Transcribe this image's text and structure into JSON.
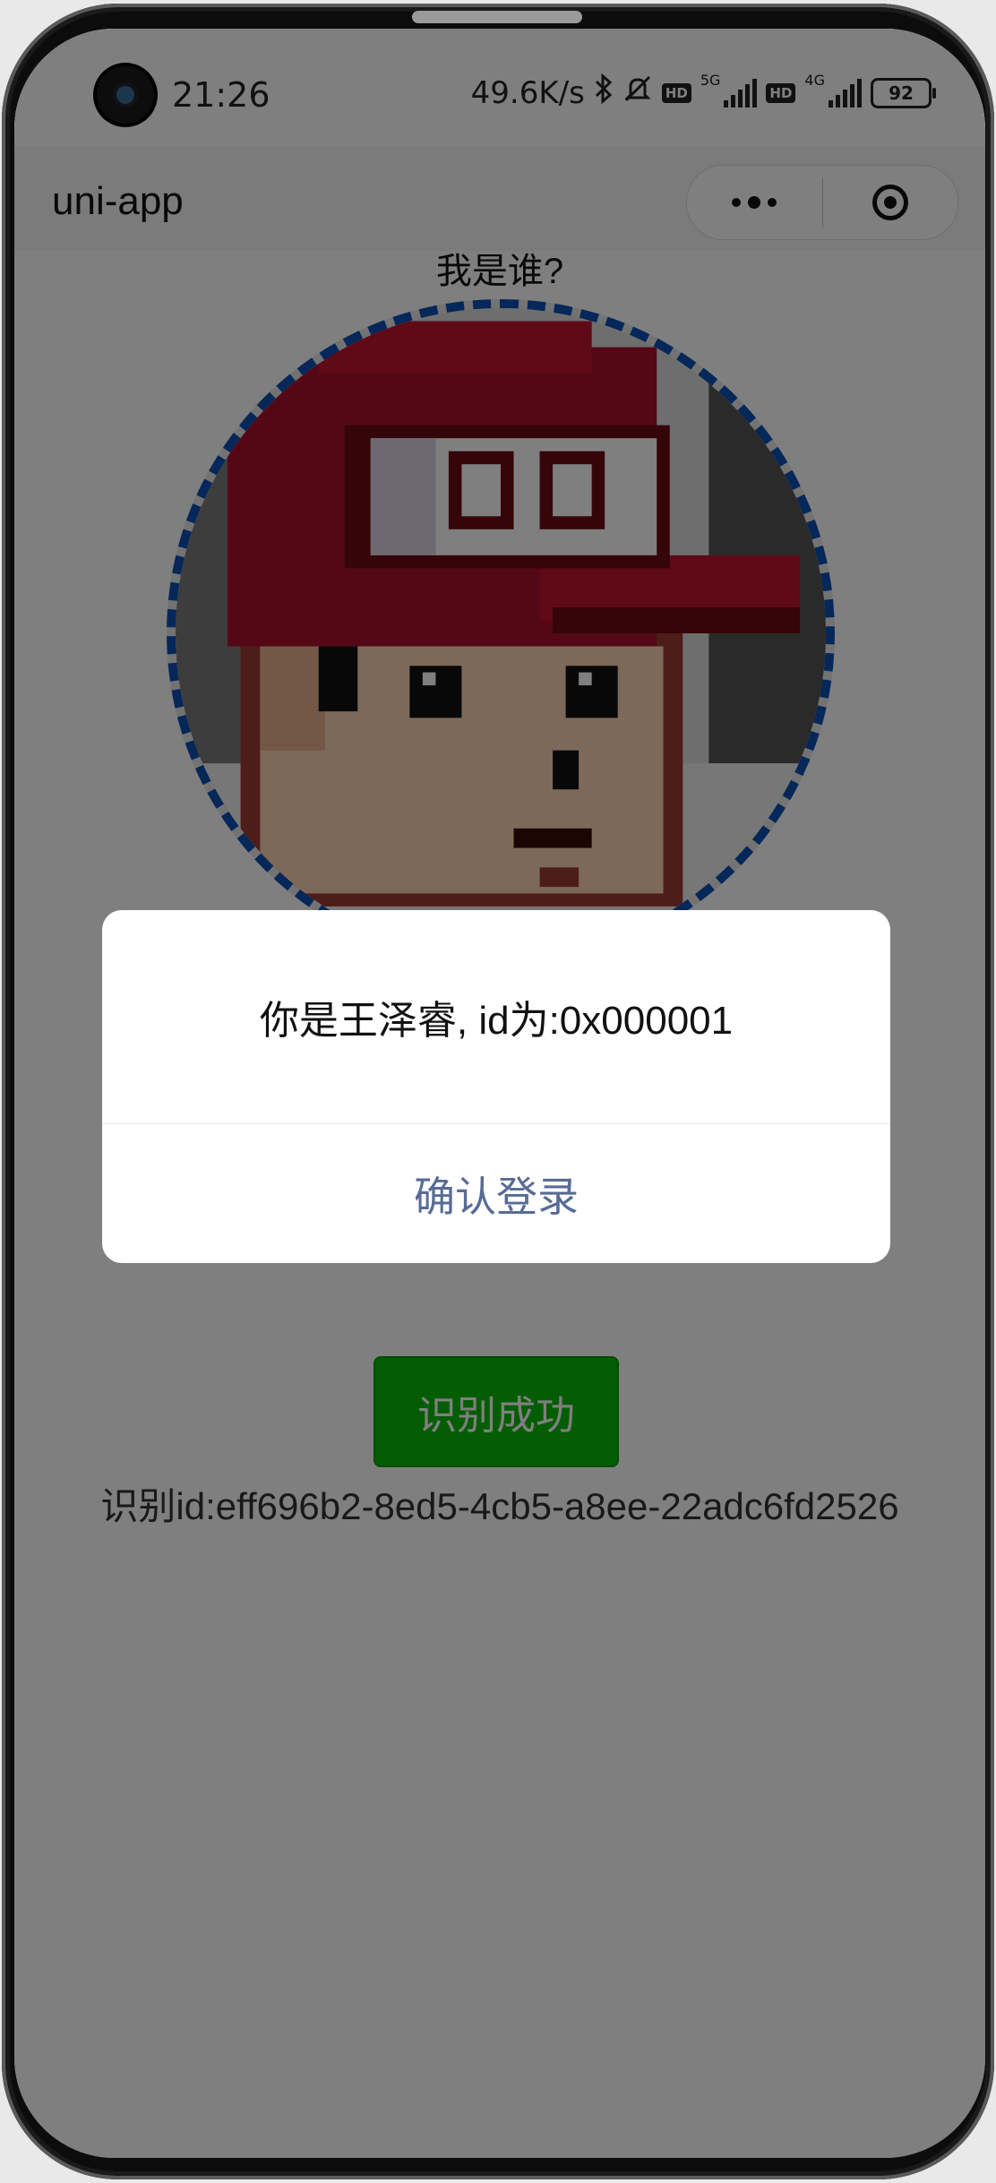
{
  "status_bar": {
    "time": "21:26",
    "speed": "49.6K/s",
    "hd_label": "HD",
    "net_5g": "5G",
    "net_4g": "4G",
    "battery": "92"
  },
  "nav": {
    "title": "uni-app"
  },
  "page": {
    "title": "我是谁?",
    "success_button": "识别成功",
    "recognition_id": "识别id:eff696b2-8ed5-4cb5-a8ee-22adc6fd2526"
  },
  "modal": {
    "message": "你是王泽睿, id为:0x000001",
    "confirm": "确认登录"
  },
  "colors": {
    "avatar_border": "#0a4fb3",
    "button": "#09bb07",
    "confirm_text": "#576b95"
  }
}
